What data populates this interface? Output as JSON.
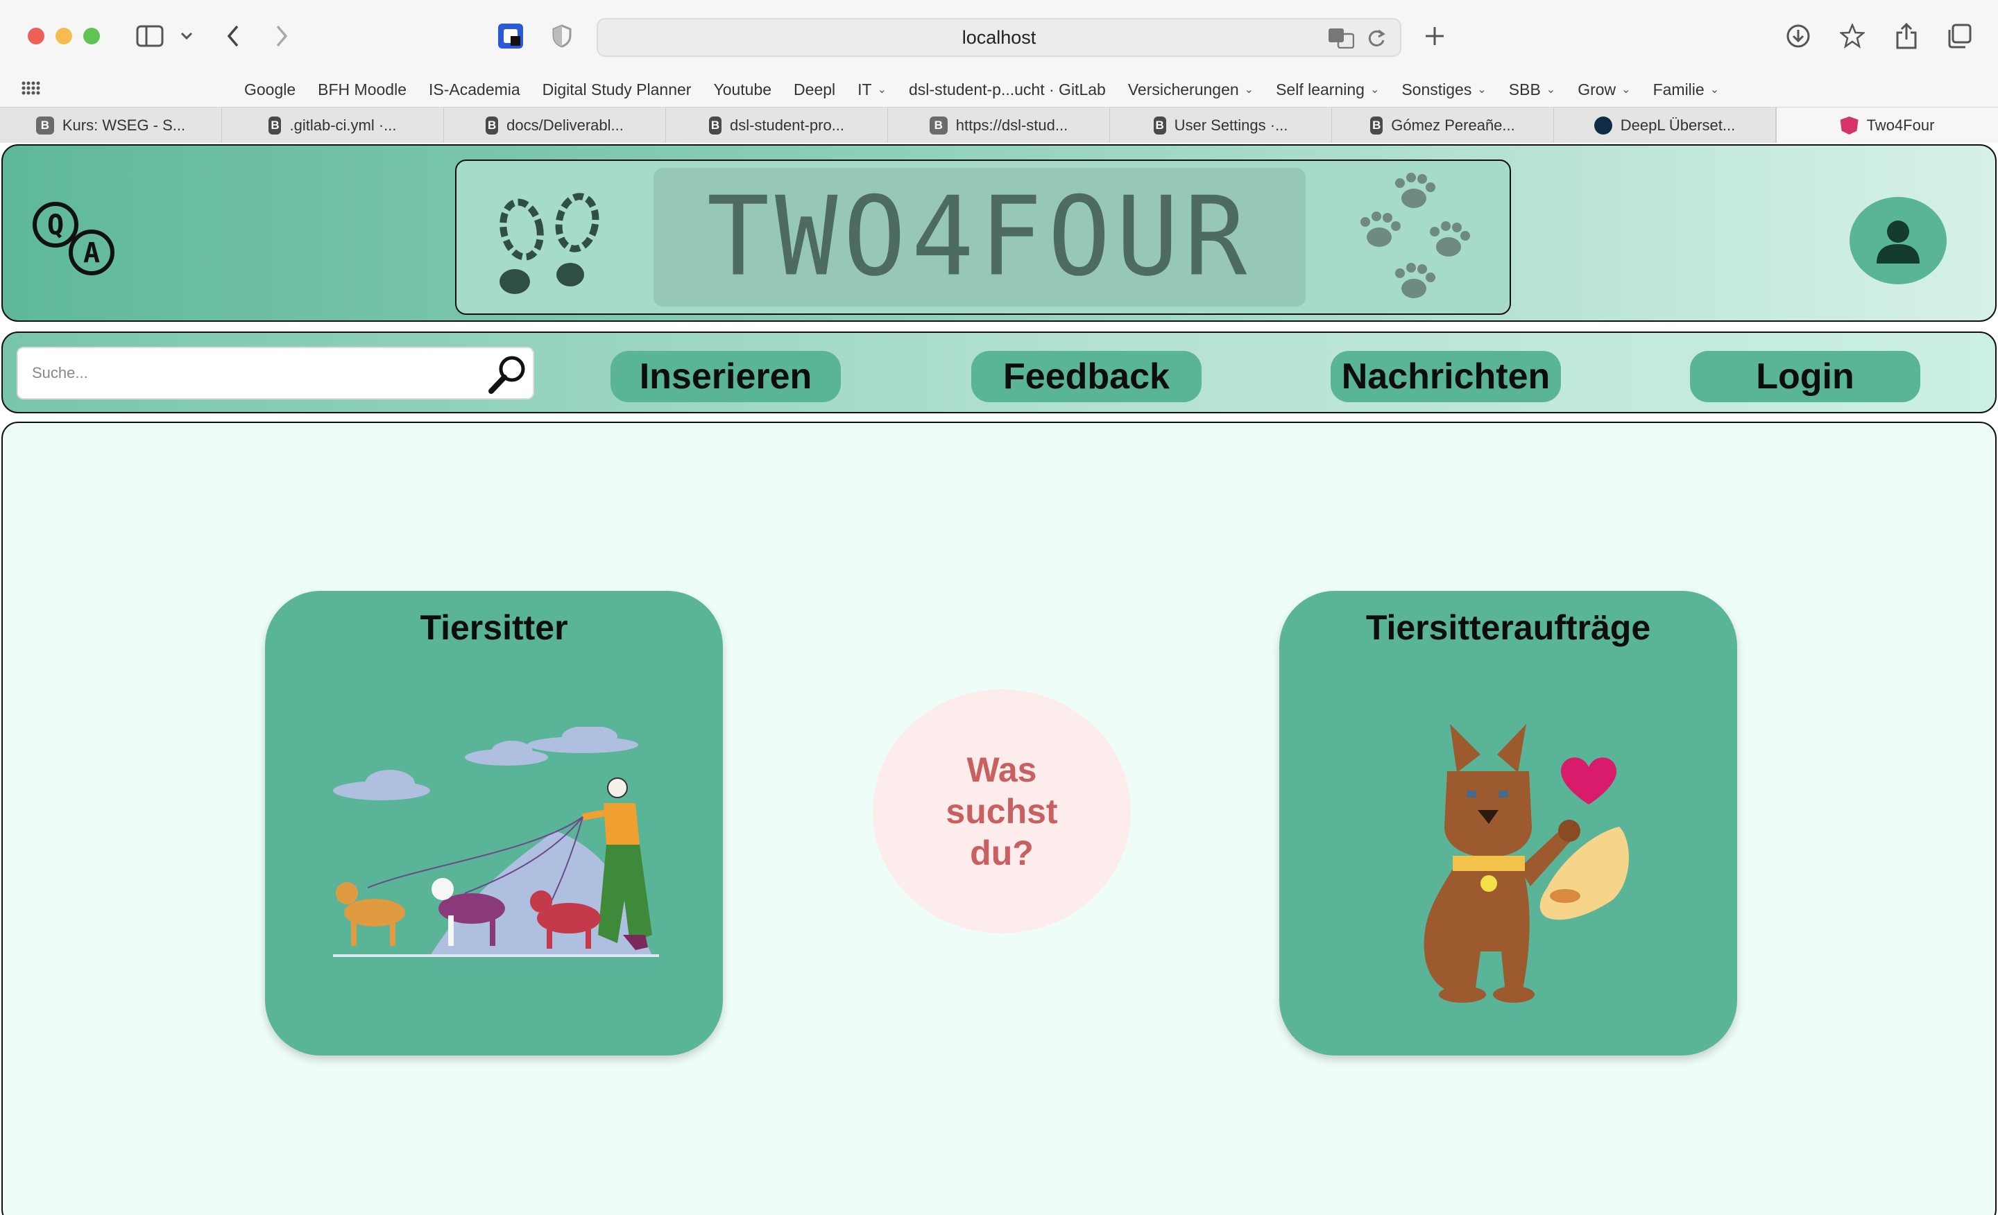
{
  "browser": {
    "url": "localhost",
    "bookmarks": [
      {
        "label": "Google",
        "dropdown": false
      },
      {
        "label": "BFH Moodle",
        "dropdown": false
      },
      {
        "label": "IS-Academia",
        "dropdown": false
      },
      {
        "label": "Digital Study Planner",
        "dropdown": false
      },
      {
        "label": "Youtube",
        "dropdown": false
      },
      {
        "label": "Deepl",
        "dropdown": false
      },
      {
        "label": "IT",
        "dropdown": true
      },
      {
        "label": "dsl-student-p...ucht · GitLab",
        "dropdown": false
      },
      {
        "label": "Versicherungen",
        "dropdown": true
      },
      {
        "label": "Self learning",
        "dropdown": true
      },
      {
        "label": "Sonstiges",
        "dropdown": true
      },
      {
        "label": "SBB",
        "dropdown": true
      },
      {
        "label": "Grow",
        "dropdown": true
      },
      {
        "label": "Familie",
        "dropdown": true
      }
    ],
    "tabs": [
      {
        "label": "Kurs: WSEG - S...",
        "icon": "B"
      },
      {
        "label": ".gitlab-ci.yml ·...",
        "icon": "B"
      },
      {
        "label": "docs/Deliverabl...",
        "icon": "B"
      },
      {
        "label": "dsl-student-pro...",
        "icon": "B"
      },
      {
        "label": "https://dsl-stud...",
        "icon": "B"
      },
      {
        "label": "User Settings ·...",
        "icon": "B"
      },
      {
        "label": "Gómez Pereañe...",
        "icon": "B"
      },
      {
        "label": "DeepL Überset...",
        "icon": "deepl"
      }
    ],
    "active_tab": "Two4Four"
  },
  "header": {
    "logo": "QA",
    "banner_text": "TWO4FOUR"
  },
  "nav": {
    "search_placeholder": "Suche...",
    "buttons": [
      "Inserieren",
      "Feedback",
      "Nachrichten",
      "Login"
    ]
  },
  "main": {
    "card_left_title": "Tiersitter",
    "card_right_title": "Tiersitteraufträge",
    "question": "Was suchst du?"
  },
  "colors": {
    "accent": "#5ab497",
    "background": "#effdf8",
    "question_bg": "#fcecec",
    "question_text": "#c86060"
  }
}
